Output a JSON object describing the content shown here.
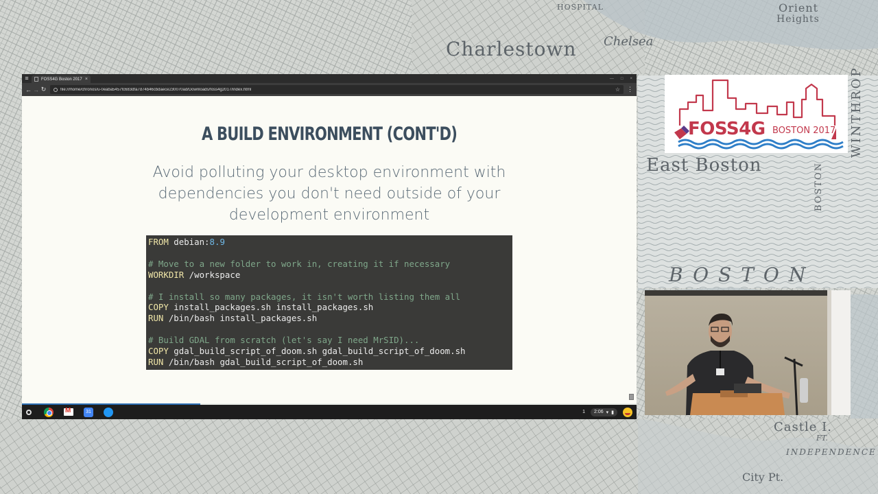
{
  "map": {
    "labels": {
      "charlestown": "Charlestown",
      "chelsea": "Chelsea",
      "orient": "Orient",
      "heights": "Heights",
      "hospital": "HOSPITAL",
      "east_boston": "East Boston",
      "boston": "BOSTON",
      "boston_vertical": "BOSTON",
      "winthrop": "WINTHROP",
      "castle": "Castle I.",
      "ft": "FT.",
      "independence": "INDEPENDENCE",
      "city_pt": "City Pt."
    }
  },
  "browser": {
    "tab_title": "FOSS4G Boston 2017",
    "url": "file:///home/chronos/u-0eaba5457fc683dfa7d74b46cbdaece230070ad/Downloads/foss4g2017/index.html",
    "progress": 0.29
  },
  "slide": {
    "title": "A BUILD ENVIRONMENT (CONT'D)",
    "subtitle_lines": [
      "Avoid polluting your desktop environment with",
      "dependencies you don't need outside of your",
      "development environment"
    ],
    "code_lines": [
      [
        {
          "t": "FROM",
          "c": "kw"
        },
        {
          "t": " debian:",
          "c": ""
        },
        {
          "t": "8.9",
          "c": "num"
        }
      ],
      [],
      [
        {
          "t": "# Move to a new folder to work in, creating it if necessary",
          "c": "cm"
        }
      ],
      [
        {
          "t": "WORKDIR",
          "c": "kw"
        },
        {
          "t": " /workspace",
          "c": ""
        }
      ],
      [],
      [
        {
          "t": "# I install so many packages, it isn't worth listing them all",
          "c": "cm"
        }
      ],
      [
        {
          "t": "COPY",
          "c": "kw"
        },
        {
          "t": " install_packages.sh install_packages.sh",
          "c": ""
        }
      ],
      [
        {
          "t": "RUN",
          "c": "kw"
        },
        {
          "t": " /bin/bash install_packages.sh",
          "c": ""
        }
      ],
      [],
      [
        {
          "t": "# Build GDAL from scratch (let's say I need MrSID)...",
          "c": "cm"
        }
      ],
      [
        {
          "t": "COPY",
          "c": "kw"
        },
        {
          "t": " gdal_build_script_of_doom.sh gdal_build_script_of_doom.sh",
          "c": ""
        }
      ],
      [
        {
          "t": "RUN",
          "c": "kw"
        },
        {
          "t": " /bin/bash gdal_build_script_of_doom.sh",
          "c": ""
        }
      ]
    ]
  },
  "shelf": {
    "calendar_day": "31",
    "tray_count": "1",
    "time": "2:06"
  },
  "logo": {
    "name": "FOSS4G",
    "sub": "BOSTON 2017",
    "color": "#c2384c",
    "wave_color": "#2f7fc8"
  },
  "colors": {
    "slide_title": "#3c4e5e",
    "code_bg": "#3a3a38",
    "keyword": "#f0e6a8",
    "comment": "#7fa78a",
    "number": "#6fb8e6",
    "progress": "#2b6db3"
  }
}
